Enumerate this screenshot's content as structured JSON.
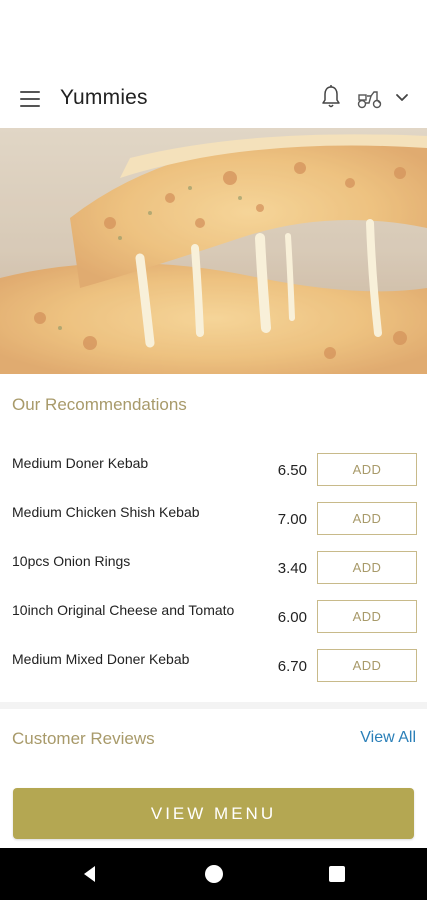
{
  "app_bar": {
    "title": "Yummies",
    "icons": [
      "menu-icon",
      "bell-icon",
      "scooter-icon",
      "chevron-down-icon"
    ]
  },
  "hero": {
    "image": "cheese-pizza-photo"
  },
  "recommendations": {
    "title": "Our Recommendations",
    "add_label": "ADD",
    "items": [
      {
        "name": "Medium Doner Kebab",
        "price": "6.50"
      },
      {
        "name": "Medium Chicken Shish Kebab",
        "price": "7.00"
      },
      {
        "name": "10pcs Onion Rings",
        "price": "3.40"
      },
      {
        "name": "10inch Original Cheese and Tomato",
        "price": "6.00"
      },
      {
        "name": "Medium Mixed Doner Kebab",
        "price": "6.70"
      }
    ]
  },
  "reviews": {
    "title": "Customer Reviews",
    "view_all": "View All"
  },
  "cta": {
    "label": "VIEW MENU"
  },
  "colors": {
    "accent": "#b4a752",
    "accent_text": "#a89a6a",
    "link": "#2a7fb8"
  },
  "nav": {
    "icons": [
      "back-icon",
      "home-icon",
      "recents-icon"
    ]
  }
}
